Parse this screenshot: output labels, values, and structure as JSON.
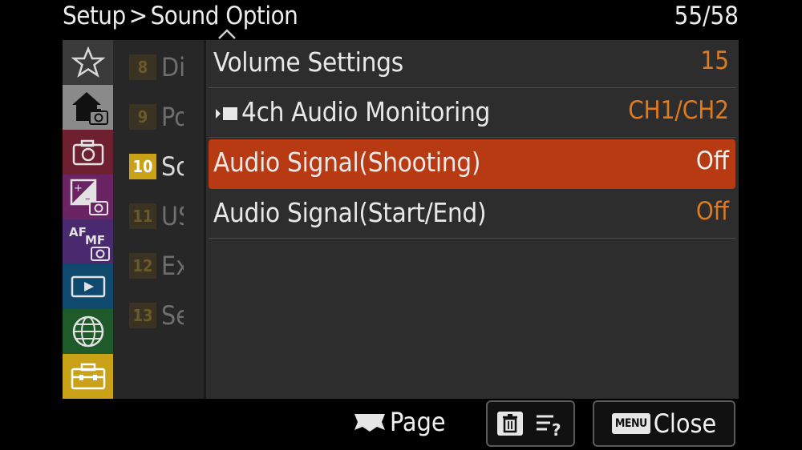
{
  "header": {
    "breadcrumb_root": "Setup",
    "breadcrumb_sep": ">",
    "breadcrumb_current": "Sound Option",
    "page_count": "55/58"
  },
  "categories": [
    {
      "name": "my-menu",
      "icon": "star-icon",
      "color": "#3b3b3b"
    },
    {
      "name": "main-shooting",
      "icon": "home-camera-icon",
      "color": "#8a8a8a",
      "active": true
    },
    {
      "name": "shooting",
      "icon": "camera-icon",
      "color": "#6e1f30"
    },
    {
      "name": "exposure-color",
      "icon": "exposure-camera-icon",
      "color": "#6a2464"
    },
    {
      "name": "focus",
      "icon": "af-mf-camera-icon",
      "color": "#4a2a6e"
    },
    {
      "name": "playback",
      "icon": "play-icon",
      "color": "#0f4a6e"
    },
    {
      "name": "network",
      "icon": "globe-icon",
      "color": "#1e5a2a"
    },
    {
      "name": "setup",
      "icon": "toolbox-icon",
      "color": "#c9a218",
      "selected": true
    }
  ],
  "submenu": [
    {
      "num": "8",
      "text": "Di"
    },
    {
      "num": "9",
      "text": "Po"
    },
    {
      "num": "10",
      "text": "Sc",
      "active": true
    },
    {
      "num": "11",
      "text": "US"
    },
    {
      "num": "12",
      "text": "Ex"
    },
    {
      "num": "13",
      "text": "Se"
    }
  ],
  "items": [
    {
      "label": "Volume Settings",
      "value": "15"
    },
    {
      "label": "4ch Audio Monitoring",
      "value": "CH1/CH2",
      "movie_icon": true
    },
    {
      "label": "Audio Signal(Shooting)",
      "value": "Off",
      "selected": true
    },
    {
      "label": "Audio Signal(Start/End)",
      "value": "Off"
    }
  ],
  "footer": {
    "page_label": "Page",
    "close_label": "Close",
    "menu_badge": "MENU"
  },
  "colors": {
    "accent_orange": "#e07a1e",
    "selection_red": "#b73a12",
    "setup_yellow": "#c9a218"
  }
}
